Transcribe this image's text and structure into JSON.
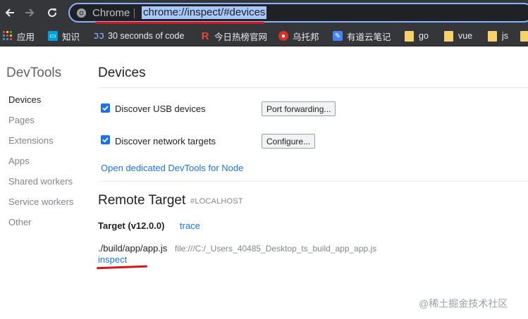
{
  "browser": {
    "site_name": "Chrome",
    "url": "chrome://inspect/#devices"
  },
  "bookmarks": [
    {
      "label": "应用",
      "icon": "apps-grid-icon"
    },
    {
      "label": "知识",
      "icon": "bilibili-icon"
    },
    {
      "label": "30 seconds of code",
      "icon": "code-icon"
    },
    {
      "label": "今日热榜官网",
      "icon": "r-logo-icon"
    },
    {
      "label": "乌托邦",
      "icon": "red-circle-icon"
    },
    {
      "label": "有道云笔记",
      "icon": "youdao-note-icon"
    },
    {
      "label": "go",
      "icon": "folder-icon"
    },
    {
      "label": "vue",
      "icon": "folder-icon"
    },
    {
      "label": "js",
      "icon": "folder-icon"
    }
  ],
  "sidebar": {
    "title": "DevTools",
    "items": [
      "Devices",
      "Pages",
      "Extensions",
      "Apps",
      "Shared workers",
      "Service workers",
      "Other"
    ],
    "active": "Devices"
  },
  "devices": {
    "title": "Devices",
    "discover_usb_label": "Discover USB devices",
    "port_forwarding_button": "Port forwarding...",
    "discover_network_label": "Discover network targets",
    "configure_button": "Configure...",
    "node_link": "Open dedicated DevTools for Node"
  },
  "remote_target": {
    "title": "Remote Target",
    "host_tag": "#LOCALHOST",
    "target_name": "Target (v12.0.0)",
    "trace_link": "trace",
    "script_path": "./build/app/app.js",
    "script_url": "file:///C:/_Users_40485_Desktop_ts_build_app_app.js",
    "inspect_link": "inspect"
  },
  "watermark": "@稀土掘金技术社区",
  "colors": {
    "accent": "#1a73e8",
    "annotation": "#d91414",
    "toolbar": "#35363a"
  }
}
